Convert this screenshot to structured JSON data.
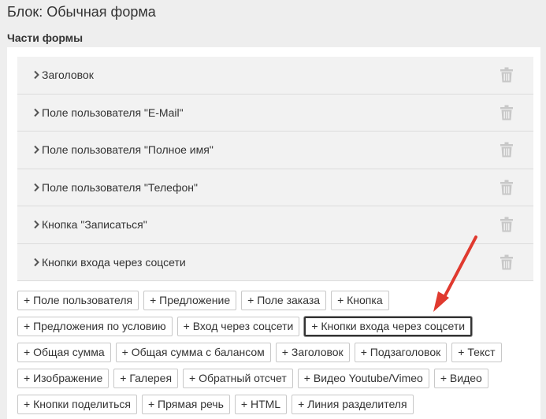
{
  "page": {
    "title": "Блок: Обычная форма",
    "section_title": "Части формы"
  },
  "parts": [
    {
      "label": "Заголовок"
    },
    {
      "label": "Поле пользователя \"E-Mail\""
    },
    {
      "label": "Поле пользователя \"Полное имя\""
    },
    {
      "label": "Поле пользователя \"Телефон\""
    },
    {
      "label": "Кнопка \"Записаться\""
    },
    {
      "label": "Кнопки входа через соцсети"
    }
  ],
  "add_buttons": {
    "row1": [
      "+ Поле пользователя",
      "+ Предложение",
      "+ Поле заказа",
      "+ Кнопка"
    ],
    "row2": [
      "+ Предложения по условию",
      "+ Вход через соцсети",
      "+ Кнопки входа через соцсети"
    ],
    "row3": [
      "+ Общая сумма",
      "+ Общая сумма с балансом",
      "+ Заголовок",
      "+ Подзаголовок",
      "+ Текст"
    ],
    "row4": [
      "+ Изображение",
      "+ Галерея",
      "+ Обратный отсчет",
      "+ Видео Youtube/Vimeo",
      "+ Видео"
    ],
    "row5": [
      "+ Кнопки поделиться",
      "+ Прямая речь",
      "+ HTML",
      "+ Линия разделителя"
    ]
  },
  "colors": {
    "annotation_arrow": "#e03a2f",
    "trash_icon": "#c8c8c8"
  }
}
